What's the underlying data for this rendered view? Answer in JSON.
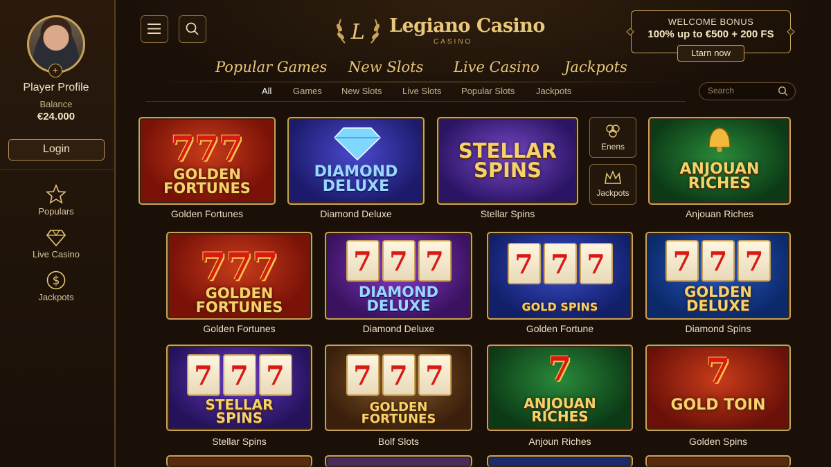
{
  "sidebar": {
    "profile_name": "Player Profile",
    "balance_label": "Balance",
    "balance_value": "€24.000",
    "login_label": "Login",
    "nav": [
      {
        "label": "Populars",
        "icon": "star-icon"
      },
      {
        "label": "Live Casino",
        "icon": "diamond-icon"
      },
      {
        "label": "Jackpots",
        "icon": "dollar-coin-icon"
      }
    ]
  },
  "header": {
    "logo_title": "Legiano Casino",
    "logo_sub": "CASINO",
    "bonus": {
      "title": "WELCOME BONUS",
      "main": "100% up to €500 + 200 FS",
      "cta": "Ltarn now"
    },
    "main_tabs": [
      "Popular Games",
      "New Slots",
      "Live Casino",
      "Jackpots"
    ],
    "sub_tabs": [
      "All",
      "Games",
      "New Slots",
      "Live Slots",
      "Popular Slots",
      "Jackpots"
    ],
    "search_placeholder": "Search"
  },
  "side_buttons": [
    {
      "label": "Enens",
      "icon": "clover-icon"
    },
    {
      "label": "Jackpots",
      "icon": "crown-icon"
    }
  ],
  "games_row1": [
    {
      "art_title": "GOLDEN FORTUNES",
      "art_top": "777",
      "caption": "Golden Fortunes"
    },
    {
      "art_title": "DIAMOND DELUXE",
      "caption": "Diamond Deluxe"
    },
    {
      "art_title": "STELLAR SPINS",
      "caption": "Stellar Spins"
    },
    {
      "art_title": "ANJOUAN RICHES",
      "caption": "Anjouan Riches"
    }
  ],
  "games_row2": [
    {
      "art_title": "GOLDEN FORTUNES",
      "art_top": "777",
      "caption": "Golden Fortunes"
    },
    {
      "art_title": "DIAMOND DELUXE",
      "reels": [
        "7",
        "7",
        "7"
      ],
      "caption": "Diamond Deluxe"
    },
    {
      "art_title": "GOLD SPINS",
      "reels": [
        "7",
        "7",
        "7"
      ],
      "caption": "Golden Fortune"
    },
    {
      "art_title": "GOLDEN DELUXE",
      "reels": [
        "7",
        "7",
        "7"
      ],
      "caption": "Diamond Spins"
    }
  ],
  "games_row3": [
    {
      "art_title": "STELLAR SPINS",
      "reels": [
        "7",
        "7",
        "7"
      ],
      "caption": "Stellar Spins"
    },
    {
      "art_title": "GOLDEN FORTUNES",
      "reels": [
        "7",
        "7",
        "7"
      ],
      "caption": "Bolf Slots"
    },
    {
      "art_title": "ANJOUAN RICHES",
      "art_top": "7",
      "caption": "Anjoun Riches"
    },
    {
      "art_title": "GOLD TOIN",
      "art_top": "7",
      "caption": "Golden Spins"
    }
  ],
  "colors": {
    "gold": "#c9a35a",
    "gold_text": "#e8c77a",
    "background": "#1a1008"
  }
}
